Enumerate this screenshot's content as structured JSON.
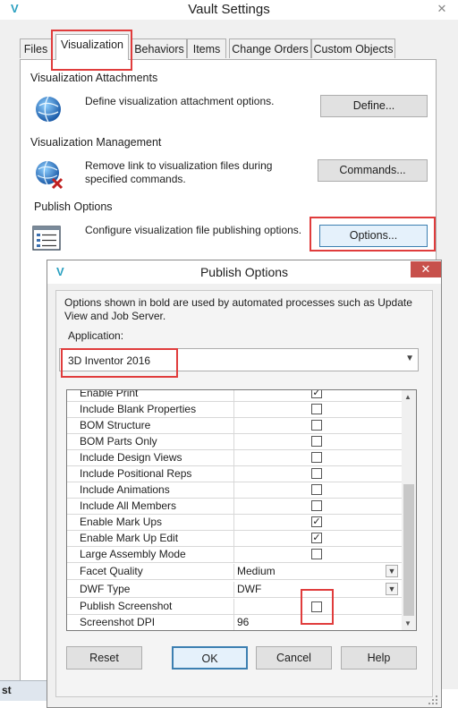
{
  "vault": {
    "title": "Vault Settings",
    "close_glyph": "✕",
    "app_icon": "V",
    "tabs": [
      "Files",
      "Visualization",
      "Behaviors",
      "Items",
      "Change Orders",
      "Custom Objects"
    ],
    "sections": {
      "attachments": {
        "title": "Visualization Attachments",
        "description": "Define visualization attachment options.",
        "button": "Define...",
        "icon": "globe-icon"
      },
      "management": {
        "title": "Visualization Management",
        "description_line1": "Remove link to visualization files during",
        "description_line2": "specified commands.",
        "button": "Commands...",
        "icon": "globe-remove-icon"
      },
      "publish": {
        "title": "Publish Options",
        "description": "Configure visualization file publishing options.",
        "button": "Options...",
        "icon": "settings-list-icon"
      }
    },
    "background_fragment": "st"
  },
  "publish_dialog": {
    "title": "Publish Options",
    "close_glyph": "✕",
    "app_icon": "V",
    "info_line1": "Options shown in bold are used by automated processes such as Update",
    "info_line2": "View and Job Server.",
    "application_label": "Application:",
    "application_value": "3D Inventor 2016",
    "options": [
      {
        "label": "Enable Print",
        "checked": true
      },
      {
        "label": "Include Blank Properties",
        "checked": false
      },
      {
        "label": "BOM Structure",
        "checked": false
      },
      {
        "label": "BOM Parts Only",
        "checked": false
      },
      {
        "label": "Include Design Views",
        "checked": false
      },
      {
        "label": "Include Positional Reps",
        "checked": false
      },
      {
        "label": "Include Animations",
        "checked": false
      },
      {
        "label": "Include All Members",
        "checked": false
      },
      {
        "label": "Enable Mark Ups",
        "checked": true
      },
      {
        "label": "Enable Mark Up Edit",
        "checked": true
      },
      {
        "label": "Large Assembly Mode",
        "checked": false
      }
    ],
    "facet_quality": {
      "label": "Facet Quality",
      "value": "Medium"
    },
    "dwf_type": {
      "label": "DWF Type",
      "value": "DWF"
    },
    "publish_screenshot": {
      "label": "Publish Screenshot",
      "checked": false
    },
    "screenshot_dpi": {
      "label": "Screenshot DPI",
      "value": "96"
    },
    "buttons": {
      "reset": "Reset",
      "ok": "OK",
      "cancel": "Cancel",
      "help": "Help"
    },
    "check_glyph": "✓",
    "arrow_glyph": "▼"
  },
  "colors": {
    "highlight": "#e03c3c",
    "accent": "#2aa0c0"
  }
}
